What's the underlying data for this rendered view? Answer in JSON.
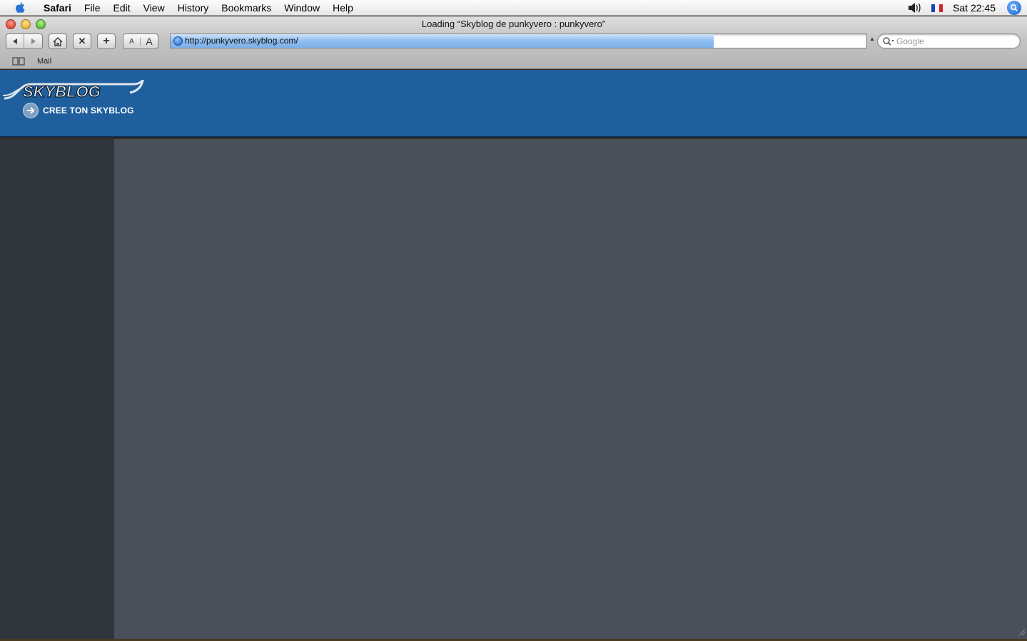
{
  "menubar": {
    "app_name": "Safari",
    "items": [
      "File",
      "Edit",
      "View",
      "History",
      "Bookmarks",
      "Window",
      "Help"
    ],
    "clock": "Sat 22:45"
  },
  "window": {
    "title": "Loading “Skyblog de punkyvero : punkyvero”"
  },
  "toolbar": {
    "font_small_label": "A",
    "font_large_label": "A",
    "add_label": "+",
    "stop_label": "✕"
  },
  "address_bar": {
    "url": "http://punkyvero.skyblog.com/",
    "load_progress": 0.78
  },
  "search": {
    "placeholder": "Google"
  },
  "bookmarks_bar": {
    "items": [
      "Mail"
    ]
  },
  "page": {
    "logo_text": "SKYBLOG",
    "cta_label": "CREE TON SKYBLOG"
  },
  "colors": {
    "header_blue": "#1f5f9e",
    "sidebar": "#31353c",
    "main": "#4a505a"
  }
}
